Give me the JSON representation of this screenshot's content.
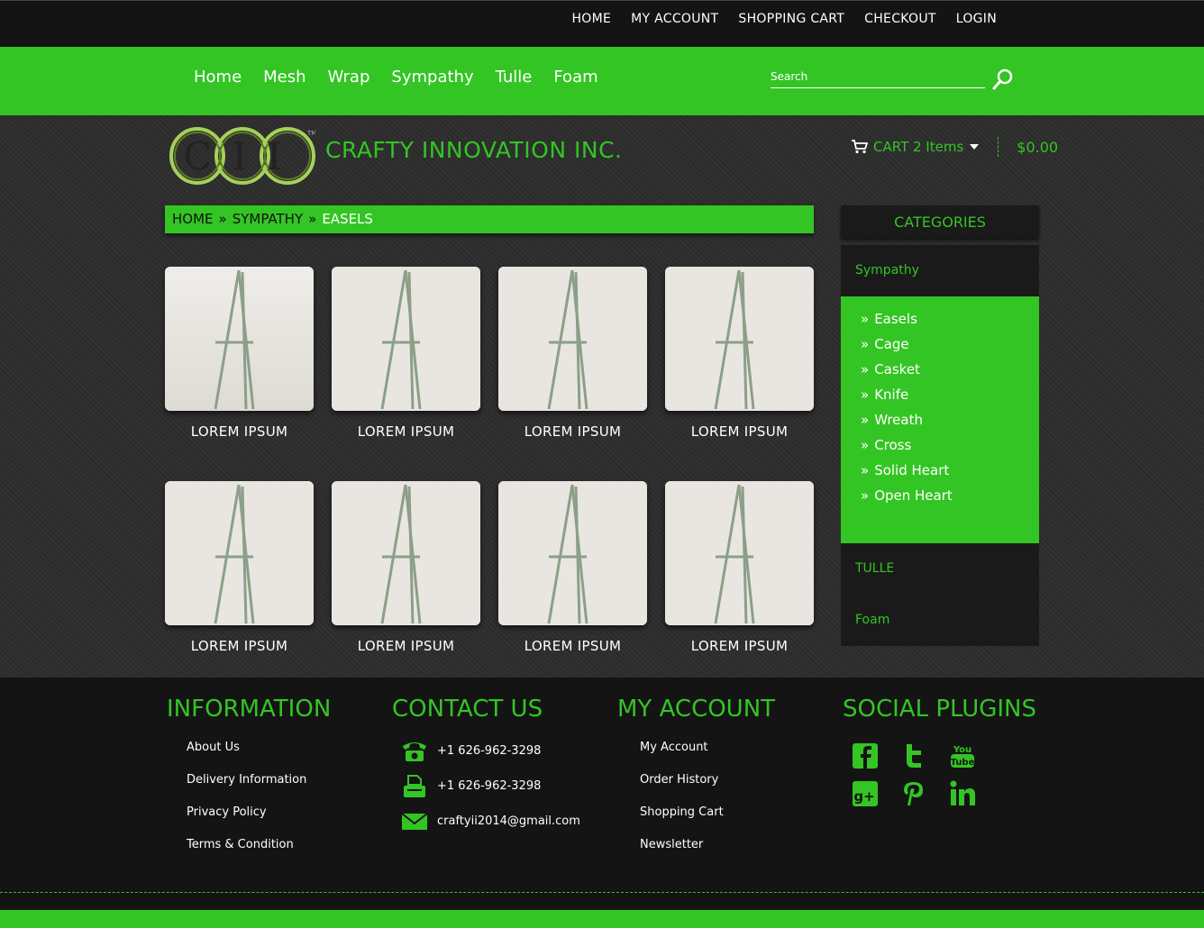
{
  "topbar": {
    "links": [
      "HOME",
      "MY ACCOUNT",
      "SHOPPING CART",
      "CHECKOUT",
      "LOGIN"
    ]
  },
  "nav": {
    "items": [
      "Home",
      "Mesh",
      "Wrap",
      "Sympathy",
      "Tulle",
      "Foam"
    ],
    "search_placeholder": "Search"
  },
  "header": {
    "logo_letters": "CII",
    "logo_mark": "TM",
    "brand": "CRAFTY INNOVATION INC.",
    "cart_label": "CART 2 Items",
    "cart_total": "$0.00"
  },
  "breadcrumb": {
    "items": [
      "HOME",
      "SYMPATHY",
      "EASELS"
    ],
    "separator": "»"
  },
  "products": [
    {
      "name": "LOREM IPSUM"
    },
    {
      "name": "LOREM IPSUM"
    },
    {
      "name": "LOREM IPSUM"
    },
    {
      "name": "LOREM IPSUM"
    },
    {
      "name": "LOREM IPSUM"
    },
    {
      "name": "LOREM IPSUM"
    },
    {
      "name": "LOREM IPSUM"
    },
    {
      "name": "LOREM IPSUM"
    }
  ],
  "sidebar": {
    "title": "CATEGORIES",
    "parent": "Sympathy",
    "chevron": "»",
    "subitems": [
      "Easels",
      "Cage",
      "Casket",
      "Knife",
      "Wreath",
      "Cross",
      "Solid Heart",
      "Open Heart"
    ],
    "others": [
      "TULLE",
      "Foam"
    ]
  },
  "footer": {
    "information": {
      "title": "INFORMATION",
      "links": [
        "About Us",
        "Delivery Information",
        "Privacy Policy",
        "Terms & Condition"
      ]
    },
    "contact": {
      "title": "CONTACT US",
      "phone": "+1 626-962-3298",
      "fax": "+1 626-962-3298",
      "email": "craftyii2014@gmail.com"
    },
    "account": {
      "title": "MY ACCOUNT",
      "links": [
        "My Account",
        "Order History",
        "Shopping Cart",
        "Newsletter"
      ]
    },
    "social": {
      "title": "SOCIAL PLUGINS",
      "icons": [
        "facebook-icon",
        "twitter-icon",
        "youtube-icon",
        "google-plus-icon",
        "pinterest-icon",
        "linkedin-icon"
      ]
    }
  },
  "colors": {
    "accent": "#33c524",
    "dark": "#141414",
    "panel": "#1a1a1a"
  }
}
